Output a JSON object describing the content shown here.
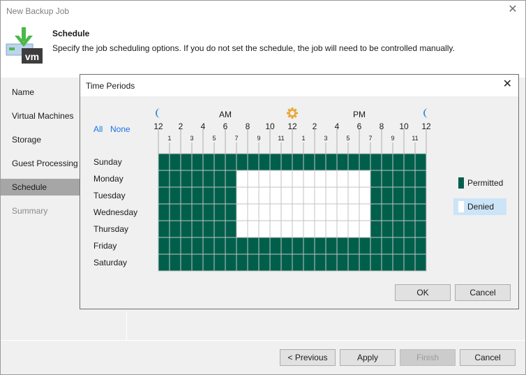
{
  "window": {
    "title": "New Backup Job",
    "close_icon": "close-icon"
  },
  "header": {
    "icon": "vm-backup-icon",
    "title": "Schedule",
    "description": "Specify the job scheduling options. If you do not set the schedule, the job will need to be controlled manually."
  },
  "sidebar": {
    "items": [
      {
        "label": "Name",
        "state": "normal"
      },
      {
        "label": "Virtual Machines",
        "state": "normal"
      },
      {
        "label": "Storage",
        "state": "normal"
      },
      {
        "label": "Guest Processing",
        "state": "normal"
      },
      {
        "label": "Schedule",
        "state": "active"
      },
      {
        "label": "Summary",
        "state": "disabled"
      }
    ]
  },
  "footer": {
    "previous_label": "< Previous",
    "apply_label": "Apply",
    "finish_label": "Finish",
    "cancel_label": "Cancel"
  },
  "dialog": {
    "title": "Time Periods",
    "close_icon": "close-icon",
    "select_all_label": "All",
    "select_none_label": "None",
    "am_label": "AM",
    "pm_label": "PM",
    "icons": [
      "moon-icon",
      "sun-icon",
      "moon-icon"
    ],
    "major_hour_labels": [
      "12",
      "2",
      "4",
      "6",
      "8",
      "10",
      "12",
      "2",
      "4",
      "6",
      "8",
      "10",
      "12"
    ],
    "minor_hour_labels": [
      "1",
      "3",
      "5",
      "7",
      "9",
      "11",
      "1",
      "3",
      "5",
      "7",
      "9",
      "11"
    ],
    "days": [
      "Sunday",
      "Monday",
      "Tuesday",
      "Wednesday",
      "Thursday",
      "Friday",
      "Saturday"
    ],
    "grid": [
      "PPPPPPPPPPPPPPPPPPPPPPPP",
      "PPPPPPPDDDDDDDDDDDDPPPPP",
      "PPPPPPPDDDDDDDDDDDDPPPPP",
      "PPPPPPPDDDDDDDDDDDDPPPPP",
      "PPPPPPPDDDDDDDDDDDDPPPPP",
      "PPPPPPPPPPPPPPPPPPPPPPPP",
      "PPPPPPPPPPPPPPPPPPPPPPPP"
    ],
    "legend": [
      {
        "key": "P",
        "label": "Permitted",
        "selected": false
      },
      {
        "key": "D",
        "label": "Denied",
        "selected": true
      }
    ],
    "colors": {
      "permitted": "#005f4b",
      "denied": "#ffffff",
      "gridline": "#c3c3c3",
      "moon": "#3a8fd3",
      "sun": "#e8a838",
      "link": "#1a73e8"
    },
    "ok_label": "OK",
    "cancel_label": "Cancel"
  }
}
